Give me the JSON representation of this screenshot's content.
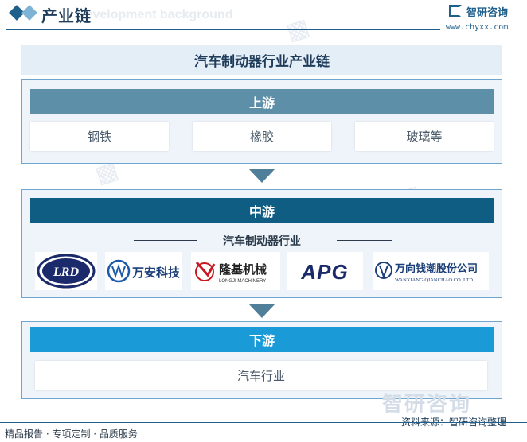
{
  "header": {
    "title": "产业链",
    "ghost_text": "Development background",
    "logo_name": "智研咨询",
    "logo_url": "www.chyxx.com"
  },
  "chart_title": "汽车制动器行业产业链",
  "upstream": {
    "label": "上游",
    "items": [
      "钢铁",
      "橡胶",
      "玻璃等"
    ]
  },
  "midstream": {
    "label": "中游",
    "sub_label": "汽车制动器行业",
    "companies": [
      {
        "logo_text": "LRD"
      },
      {
        "logo_text": "万安科技"
      },
      {
        "logo_text": "隆基机械",
        "logo_sub": "LONGJI MACHINERY"
      },
      {
        "logo_text": "APG"
      },
      {
        "logo_text": "万向钱潮股份公司",
        "logo_sub": "WANXIANG QIANCHAO CO.,LTD."
      }
    ]
  },
  "downstream": {
    "label": "下游",
    "items": [
      "汽车行业"
    ]
  },
  "footer": {
    "left": "精品报告 · 专项定制 · 品质服务",
    "source": "资料来源：智研咨询整理",
    "watermark": "智研咨询"
  },
  "colors": {
    "upstream_band": "#5e8fa8",
    "midstream_band": "#0f5d83",
    "downstream_band": "#1a9bd7",
    "arrow": "#4f7f99"
  }
}
